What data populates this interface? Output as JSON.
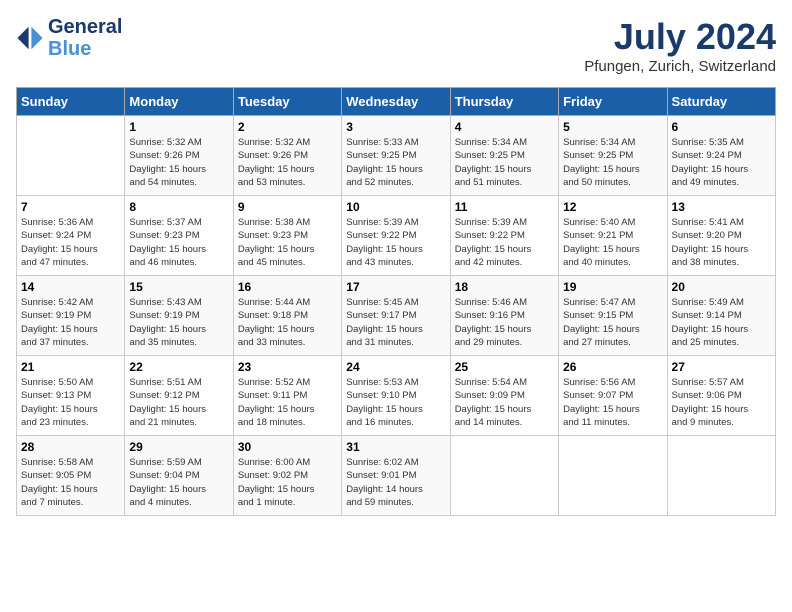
{
  "header": {
    "logo_line1": "General",
    "logo_line2": "Blue",
    "month_title": "July 2024",
    "location": "Pfungen, Zurich, Switzerland"
  },
  "days_of_week": [
    "Sunday",
    "Monday",
    "Tuesday",
    "Wednesday",
    "Thursday",
    "Friday",
    "Saturday"
  ],
  "weeks": [
    [
      {
        "day": "",
        "info": ""
      },
      {
        "day": "1",
        "info": "Sunrise: 5:32 AM\nSunset: 9:26 PM\nDaylight: 15 hours\nand 54 minutes."
      },
      {
        "day": "2",
        "info": "Sunrise: 5:32 AM\nSunset: 9:26 PM\nDaylight: 15 hours\nand 53 minutes."
      },
      {
        "day": "3",
        "info": "Sunrise: 5:33 AM\nSunset: 9:25 PM\nDaylight: 15 hours\nand 52 minutes."
      },
      {
        "day": "4",
        "info": "Sunrise: 5:34 AM\nSunset: 9:25 PM\nDaylight: 15 hours\nand 51 minutes."
      },
      {
        "day": "5",
        "info": "Sunrise: 5:34 AM\nSunset: 9:25 PM\nDaylight: 15 hours\nand 50 minutes."
      },
      {
        "day": "6",
        "info": "Sunrise: 5:35 AM\nSunset: 9:24 PM\nDaylight: 15 hours\nand 49 minutes."
      }
    ],
    [
      {
        "day": "7",
        "info": "Sunrise: 5:36 AM\nSunset: 9:24 PM\nDaylight: 15 hours\nand 47 minutes."
      },
      {
        "day": "8",
        "info": "Sunrise: 5:37 AM\nSunset: 9:23 PM\nDaylight: 15 hours\nand 46 minutes."
      },
      {
        "day": "9",
        "info": "Sunrise: 5:38 AM\nSunset: 9:23 PM\nDaylight: 15 hours\nand 45 minutes."
      },
      {
        "day": "10",
        "info": "Sunrise: 5:39 AM\nSunset: 9:22 PM\nDaylight: 15 hours\nand 43 minutes."
      },
      {
        "day": "11",
        "info": "Sunrise: 5:39 AM\nSunset: 9:22 PM\nDaylight: 15 hours\nand 42 minutes."
      },
      {
        "day": "12",
        "info": "Sunrise: 5:40 AM\nSunset: 9:21 PM\nDaylight: 15 hours\nand 40 minutes."
      },
      {
        "day": "13",
        "info": "Sunrise: 5:41 AM\nSunset: 9:20 PM\nDaylight: 15 hours\nand 38 minutes."
      }
    ],
    [
      {
        "day": "14",
        "info": "Sunrise: 5:42 AM\nSunset: 9:19 PM\nDaylight: 15 hours\nand 37 minutes."
      },
      {
        "day": "15",
        "info": "Sunrise: 5:43 AM\nSunset: 9:19 PM\nDaylight: 15 hours\nand 35 minutes."
      },
      {
        "day": "16",
        "info": "Sunrise: 5:44 AM\nSunset: 9:18 PM\nDaylight: 15 hours\nand 33 minutes."
      },
      {
        "day": "17",
        "info": "Sunrise: 5:45 AM\nSunset: 9:17 PM\nDaylight: 15 hours\nand 31 minutes."
      },
      {
        "day": "18",
        "info": "Sunrise: 5:46 AM\nSunset: 9:16 PM\nDaylight: 15 hours\nand 29 minutes."
      },
      {
        "day": "19",
        "info": "Sunrise: 5:47 AM\nSunset: 9:15 PM\nDaylight: 15 hours\nand 27 minutes."
      },
      {
        "day": "20",
        "info": "Sunrise: 5:49 AM\nSunset: 9:14 PM\nDaylight: 15 hours\nand 25 minutes."
      }
    ],
    [
      {
        "day": "21",
        "info": "Sunrise: 5:50 AM\nSunset: 9:13 PM\nDaylight: 15 hours\nand 23 minutes."
      },
      {
        "day": "22",
        "info": "Sunrise: 5:51 AM\nSunset: 9:12 PM\nDaylight: 15 hours\nand 21 minutes."
      },
      {
        "day": "23",
        "info": "Sunrise: 5:52 AM\nSunset: 9:11 PM\nDaylight: 15 hours\nand 18 minutes."
      },
      {
        "day": "24",
        "info": "Sunrise: 5:53 AM\nSunset: 9:10 PM\nDaylight: 15 hours\nand 16 minutes."
      },
      {
        "day": "25",
        "info": "Sunrise: 5:54 AM\nSunset: 9:09 PM\nDaylight: 15 hours\nand 14 minutes."
      },
      {
        "day": "26",
        "info": "Sunrise: 5:56 AM\nSunset: 9:07 PM\nDaylight: 15 hours\nand 11 minutes."
      },
      {
        "day": "27",
        "info": "Sunrise: 5:57 AM\nSunset: 9:06 PM\nDaylight: 15 hours\nand 9 minutes."
      }
    ],
    [
      {
        "day": "28",
        "info": "Sunrise: 5:58 AM\nSunset: 9:05 PM\nDaylight: 15 hours\nand 7 minutes."
      },
      {
        "day": "29",
        "info": "Sunrise: 5:59 AM\nSunset: 9:04 PM\nDaylight: 15 hours\nand 4 minutes."
      },
      {
        "day": "30",
        "info": "Sunrise: 6:00 AM\nSunset: 9:02 PM\nDaylight: 15 hours\nand 1 minute."
      },
      {
        "day": "31",
        "info": "Sunrise: 6:02 AM\nSunset: 9:01 PM\nDaylight: 14 hours\nand 59 minutes."
      },
      {
        "day": "",
        "info": ""
      },
      {
        "day": "",
        "info": ""
      },
      {
        "day": "",
        "info": ""
      }
    ]
  ]
}
